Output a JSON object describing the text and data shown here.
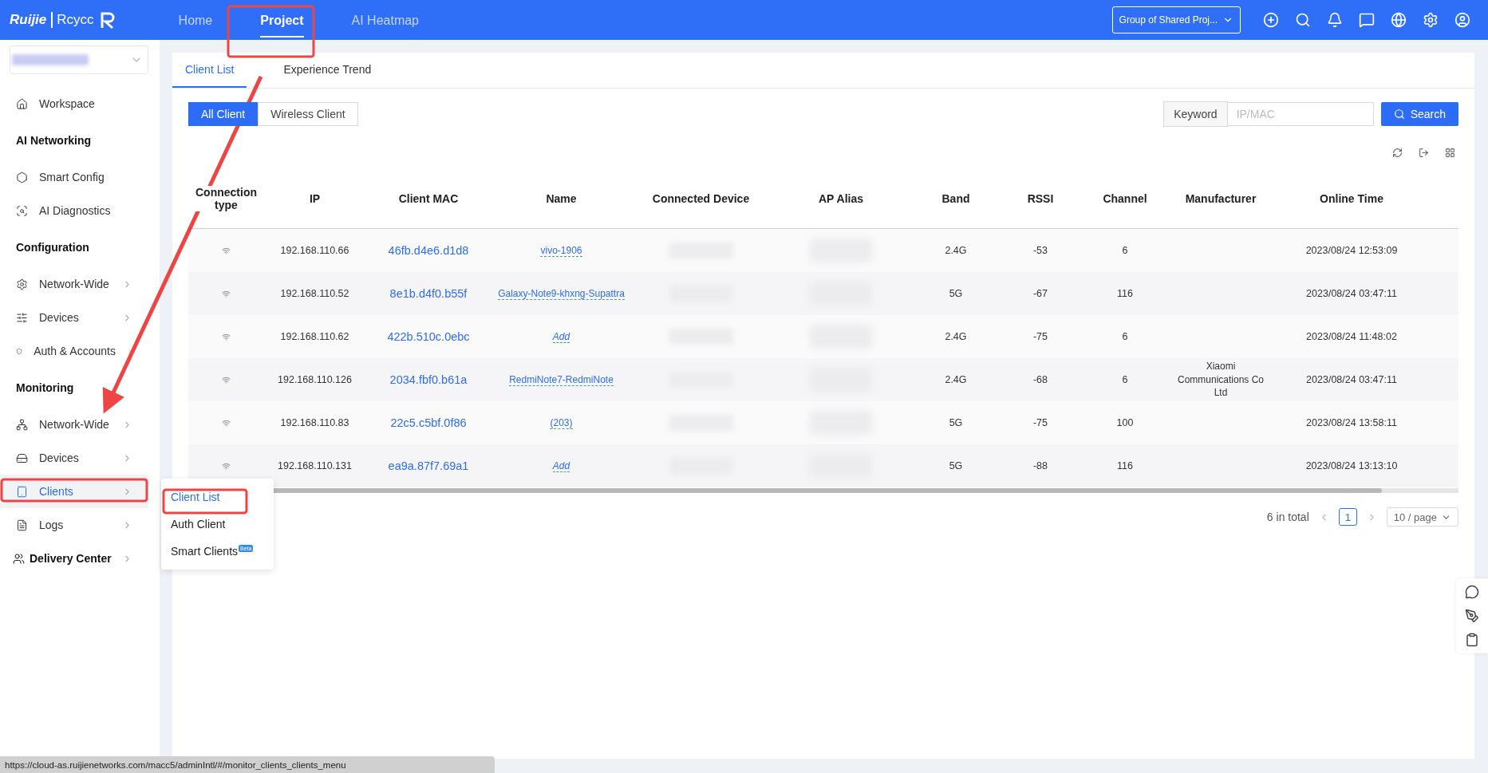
{
  "topbar": {
    "logo_text": "Ruijie",
    "logo_subtext": "Rcycc",
    "nav": [
      {
        "label": "Home",
        "selected": false
      },
      {
        "label": "Project",
        "selected": true
      },
      {
        "label": "AI Heatmap",
        "selected": false
      }
    ],
    "group_select": "Group of Shared Proj..."
  },
  "sidebar": {
    "entries": [
      {
        "kind": "item",
        "label": "Workspace",
        "selected": false,
        "submenu": false
      },
      {
        "kind": "heading",
        "label": "AI Networking"
      },
      {
        "kind": "item",
        "label": "Smart Config",
        "selected": false,
        "submenu": false
      },
      {
        "kind": "item",
        "label": "AI Diagnostics",
        "selected": false,
        "submenu": false
      },
      {
        "kind": "heading",
        "label": "Configuration"
      },
      {
        "kind": "item",
        "label": "Network-Wide",
        "selected": false,
        "submenu": true
      },
      {
        "kind": "item",
        "label": "Devices",
        "selected": false,
        "submenu": true
      },
      {
        "kind": "item",
        "label": "Auth & Accounts",
        "selected": false,
        "submenu": true
      },
      {
        "kind": "heading",
        "label": "Monitoring"
      },
      {
        "kind": "item",
        "label": "Network-Wide",
        "selected": false,
        "submenu": true
      },
      {
        "kind": "item",
        "label": "Devices",
        "selected": false,
        "submenu": true
      },
      {
        "kind": "item",
        "label": "Clients",
        "selected": true,
        "submenu": true
      },
      {
        "kind": "item",
        "label": "Logs",
        "selected": false,
        "submenu": true
      },
      {
        "kind": "group",
        "label": "Delivery Center",
        "selected": false,
        "submenu": true
      }
    ]
  },
  "flyout": {
    "items": [
      {
        "label": "Client List",
        "selected": true
      },
      {
        "label": "Auth Client",
        "selected": false
      },
      {
        "label": "Smart Clients",
        "selected": false,
        "badge": "Beta"
      }
    ]
  },
  "tabs": [
    {
      "label": "Client List",
      "selected": true
    },
    {
      "label": "Experience Trend",
      "selected": false
    }
  ],
  "filters": [
    {
      "label": "All Client",
      "selected": true
    },
    {
      "label": "Wireless Client",
      "selected": false
    }
  ],
  "search": {
    "label": "Keyword",
    "placeholder": "IP/MAC",
    "button": "Search"
  },
  "table": {
    "columns": [
      "Connection type",
      "IP",
      "Client MAC",
      "Name",
      "Connected Device",
      "AP Alias",
      "Band",
      "RSSI",
      "Channel",
      "Manufacturer",
      "Online Time"
    ],
    "rows": [
      {
        "ip": "192.168.110.66",
        "mac": "46fb.d4e6.d1d8",
        "name": {
          "kind": "name",
          "text": "vivo-1906"
        },
        "band": "2.4G",
        "rssi": "-53",
        "channel": "6",
        "time": "2023/08/24 12:53:09"
      },
      {
        "ip": "192.168.110.52",
        "mac": "8e1b.d4f0.b55f",
        "name": {
          "kind": "name",
          "text": "Galaxy-Note9-khxng-Supattra"
        },
        "band": "5G",
        "rssi": "-67",
        "channel": "116",
        "time": "2023/08/24 03:47:11"
      },
      {
        "ip": "192.168.110.62",
        "mac": "422b.510c.0ebc",
        "name": {
          "kind": "add",
          "text": "Add"
        },
        "band": "2.4G",
        "rssi": "-75",
        "channel": "6",
        "time": "2023/08/24 11:48:02"
      },
      {
        "ip": "192.168.110.126",
        "mac": "2034.fbf0.b61a",
        "name": {
          "kind": "name",
          "text": "RedmiNote7-RedmiNote"
        },
        "band": "2.4G",
        "rssi": "-68",
        "channel": "6",
        "manufacturer": "Xiaomi Communications Co Ltd",
        "time": "2023/08/24 03:47:11"
      },
      {
        "ip": "192.168.110.83",
        "mac": "22c5.c5bf.0f86",
        "name": {
          "kind": "name",
          "text": "(203)"
        },
        "band": "5G",
        "rssi": "-75",
        "channel": "100",
        "time": "2023/08/24 13:58:11"
      },
      {
        "ip": "192.168.110.131",
        "mac": "ea9a.87f7.69a1",
        "name": {
          "kind": "add",
          "text": "Add"
        },
        "band": "5G",
        "rssi": "-88",
        "channel": "116",
        "time": "2023/08/24 13:13:10"
      }
    ]
  },
  "pagination": {
    "total": "6 in total",
    "page": "1",
    "page_size": "10 / page"
  },
  "status_url": "https://cloud-as.ruijienetworks.com/macc5/adminIntl/#/monitor_clients_clients_menu"
}
